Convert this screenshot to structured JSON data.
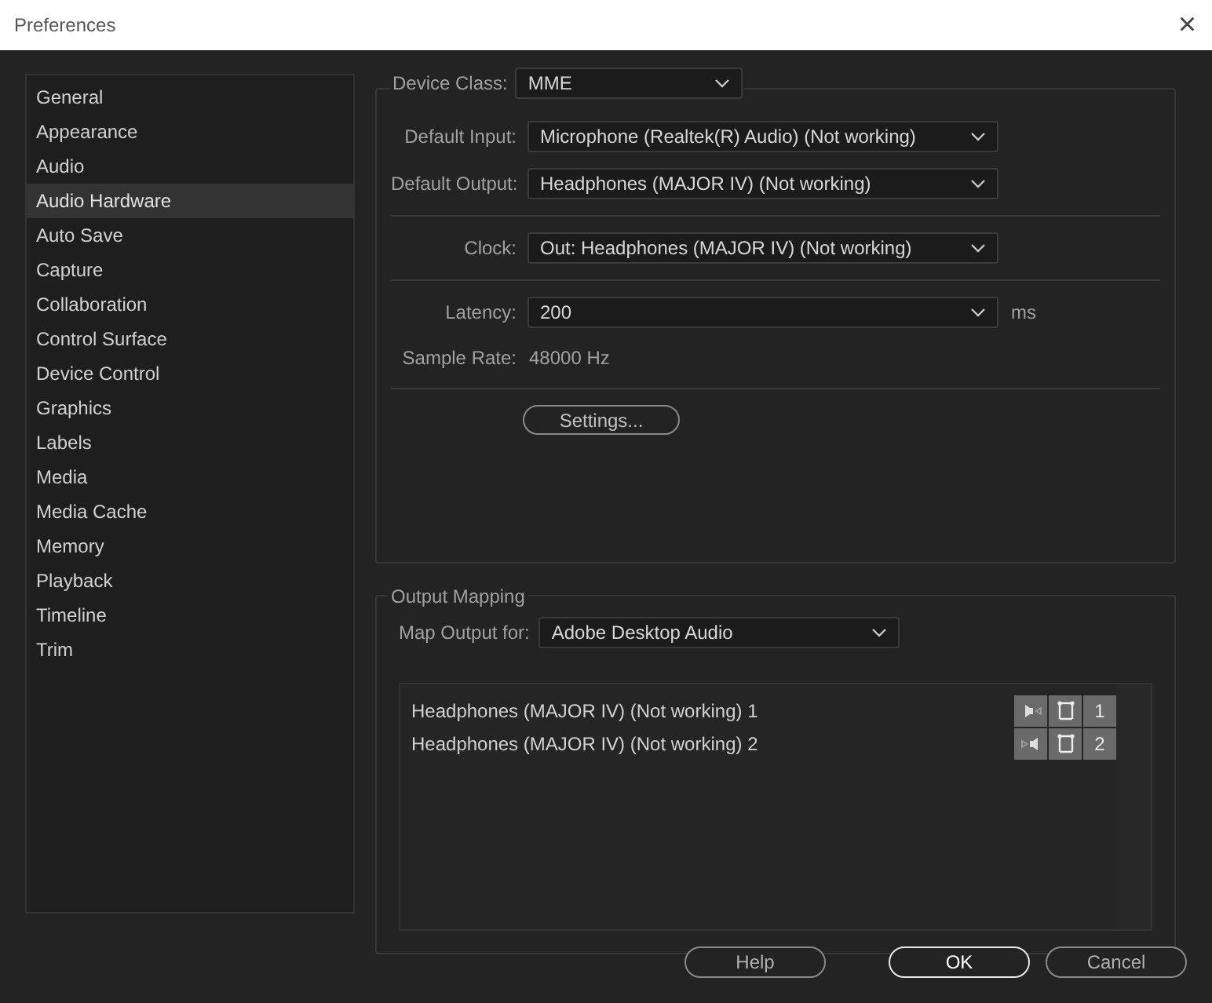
{
  "window": {
    "title": "Preferences",
    "close": "×"
  },
  "sidebar": {
    "items": [
      {
        "label": "General",
        "selected": false
      },
      {
        "label": "Appearance",
        "selected": false
      },
      {
        "label": "Audio",
        "selected": false
      },
      {
        "label": "Audio Hardware",
        "selected": true
      },
      {
        "label": "Auto Save",
        "selected": false
      },
      {
        "label": "Capture",
        "selected": false
      },
      {
        "label": "Collaboration",
        "selected": false
      },
      {
        "label": "Control Surface",
        "selected": false
      },
      {
        "label": "Device Control",
        "selected": false
      },
      {
        "label": "Graphics",
        "selected": false
      },
      {
        "label": "Labels",
        "selected": false
      },
      {
        "label": "Media",
        "selected": false
      },
      {
        "label": "Media Cache",
        "selected": false
      },
      {
        "label": "Memory",
        "selected": false
      },
      {
        "label": "Playback",
        "selected": false
      },
      {
        "label": "Timeline",
        "selected": false
      },
      {
        "label": "Trim",
        "selected": false
      }
    ]
  },
  "device_class": {
    "label": "Device Class:",
    "value": "MME"
  },
  "default_input": {
    "label": "Default Input:",
    "value": "Microphone (Realtek(R) Audio) (Not working)"
  },
  "default_output": {
    "label": "Default Output:",
    "value": "Headphones (MAJOR IV) (Not working)"
  },
  "clock": {
    "label": "Clock:",
    "value": "Out: Headphones (MAJOR IV) (Not working)"
  },
  "latency": {
    "label": "Latency:",
    "value": "200",
    "unit": "ms"
  },
  "sample_rate": {
    "label": "Sample Rate:",
    "value": "48000 Hz"
  },
  "settings_button": "Settings...",
  "output_mapping": {
    "title": "Output Mapping",
    "map_label": "Map Output for:",
    "map_value": "Adobe Desktop Audio",
    "channels": [
      {
        "name": "Headphones (MAJOR IV) (Not working) 1",
        "number": "1"
      },
      {
        "name": "Headphones (MAJOR IV) (Not working) 2",
        "number": "2"
      }
    ]
  },
  "buttons": [
    "Help",
    "OK",
    "Cancel"
  ]
}
